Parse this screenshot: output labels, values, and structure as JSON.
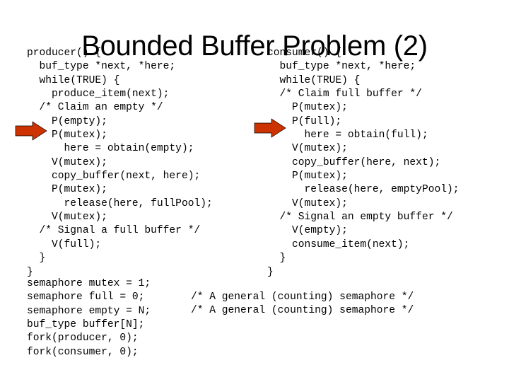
{
  "slide": {
    "title": "Bounded Buffer Problem (2)",
    "background_color": "#FFFFFF",
    "text_color": "#000000",
    "accent_color": "#CC3300"
  },
  "producer_code": {
    "name": "producer",
    "lines": [
      "producer() {",
      "  buf_type *next, *here;",
      "  while(TRUE) {",
      "    produce_item(next);",
      "  /* Claim an empty */",
      "    P(empty);",
      "    P(mutex);",
      "      here = obtain(empty);",
      "    V(mutex);",
      "    copy_buffer(next, here);",
      "    P(mutex);",
      "      release(here, fullPool);",
      "    V(mutex);",
      "  /* Signal a full buffer */",
      "    V(full);",
      "  }",
      "}"
    ]
  },
  "consumer_code": {
    "name": "consumer",
    "lines": [
      "consumer() {",
      "  buf_type *next, *here;",
      "  while(TRUE) {",
      "  /* Claim full buffer */",
      "    P(mutex);",
      "    P(full);",
      "      here = obtain(full);",
      "    V(mutex);",
      "    copy_buffer(here, next);",
      "    P(mutex);",
      "      release(here, emptyPool);",
      "    V(mutex);",
      "  /* Signal an empty buffer */",
      "    V(empty);",
      "    consume_item(next);",
      "  }",
      "}"
    ]
  },
  "declarations": {
    "lines": [
      "semaphore mutex = 1;",
      "semaphore full = 0;",
      "semaphore empty = N;",
      "buf_type buffer[N];",
      "fork(producer, 0);",
      "fork(consumer, 0);"
    ],
    "comments": [
      "/* A general (counting) semaphore */",
      "/* A general (counting) semaphore */"
    ]
  },
  "annotations": {
    "left_arrow_label": "arrow pointing at P(mutex) in producer",
    "right_arrow_label": "arrow pointing at P(full) in consumer"
  }
}
